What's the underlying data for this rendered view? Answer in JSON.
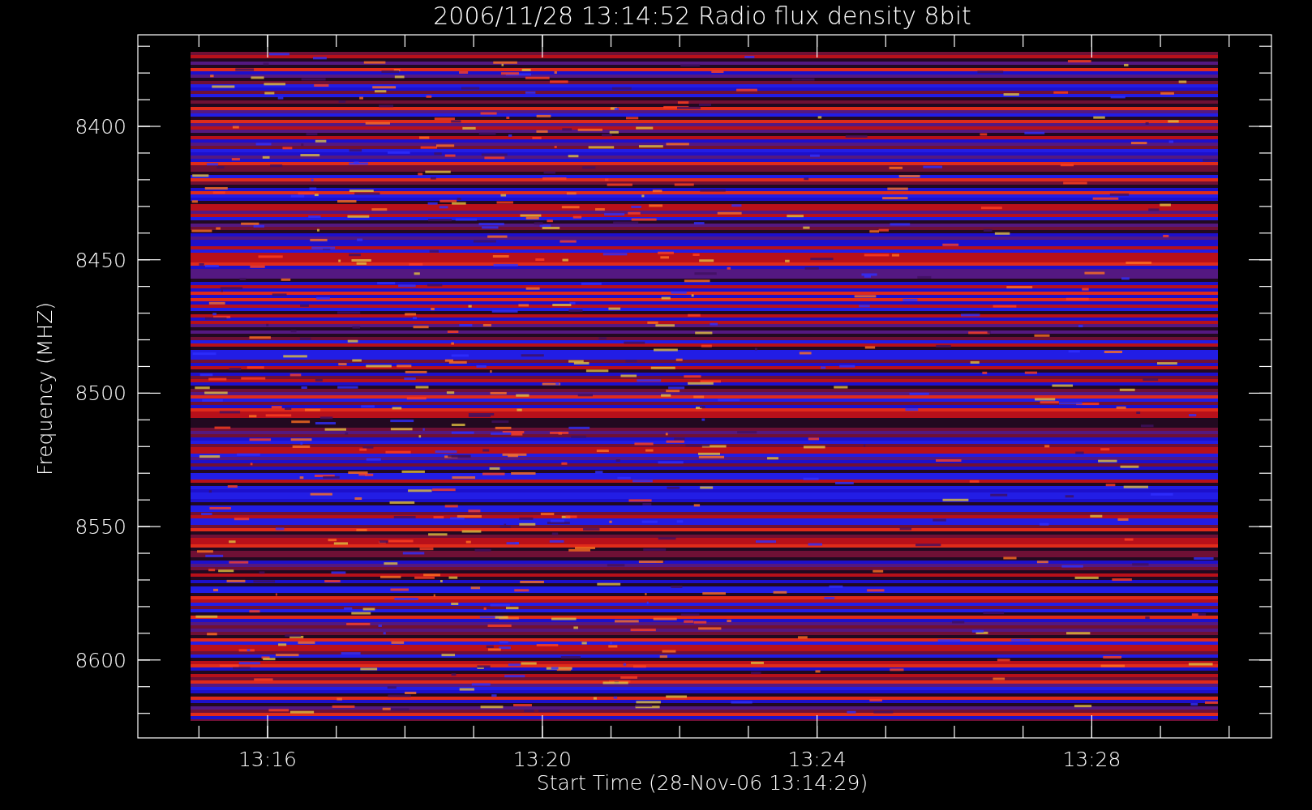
{
  "title": "2006/11/28 13:14:52 Radio flux density 8bit",
  "y_axis": {
    "label": "Frequency (MHZ)",
    "ticks": [
      "8400",
      "8450",
      "8500",
      "8550",
      "8600"
    ]
  },
  "x_axis": {
    "label": "Start Time (28-Nov-06 13:14:29)",
    "ticks": [
      "13:16",
      "13:20",
      "13:24",
      "13:28"
    ]
  }
}
